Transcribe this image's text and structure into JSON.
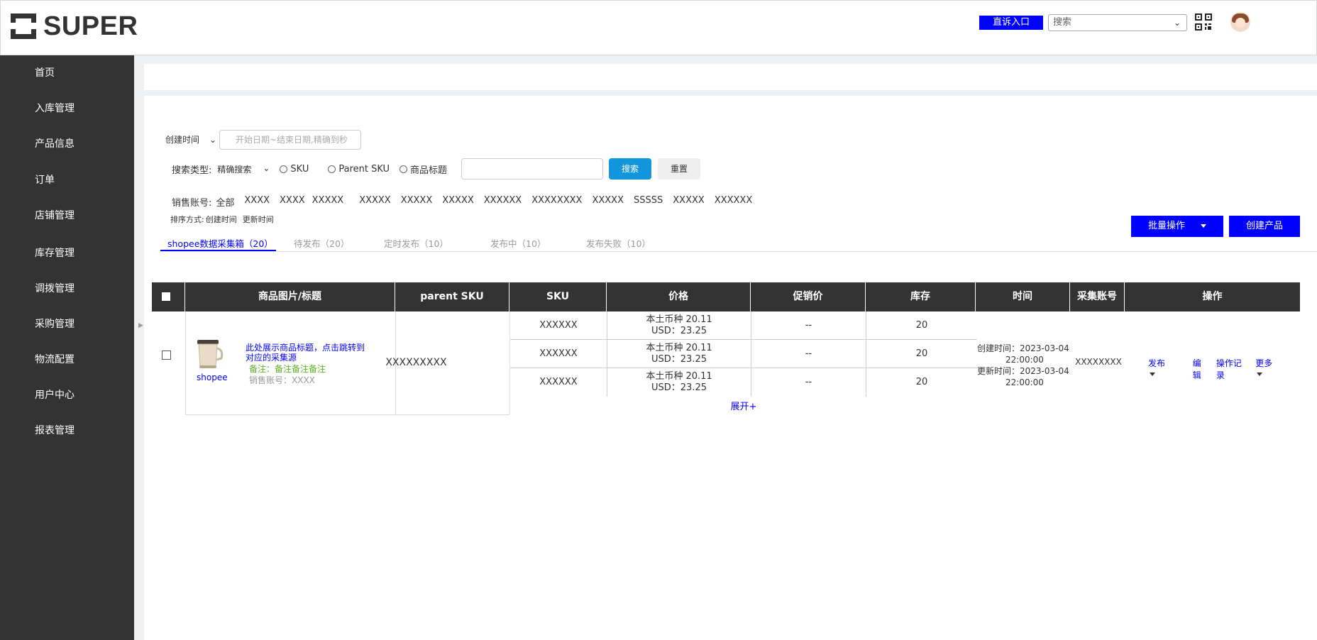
{
  "header": {
    "logo_text": "SUPER",
    "complaint_button": "直诉入口",
    "search_placeholder": "搜索"
  },
  "sidebar": {
    "items": [
      "首页",
      "入库管理",
      "产品信息",
      "订单",
      "店铺管理",
      "库存管理",
      "调拨管理",
      "采购管理",
      "物流配置",
      "用户中心",
      "报表管理"
    ]
  },
  "filters": {
    "time_select": "创建时间",
    "date_placeholder": "开始日期~结束日期,精确到秒",
    "search_type_label": "搜索类型:",
    "search_mode": "精确搜索",
    "radio_options": [
      "SKU",
      "Parent SKU",
      "商品标题"
    ],
    "search_button": "搜索",
    "reset_button": "重置",
    "accounts_label": "销售账号:",
    "accounts": [
      "全部",
      "XXXX",
      "XXXX",
      "XXXXX",
      "XXXXX",
      "XXXXX",
      "XXXXX",
      "XXXXXX",
      "XXXXXXXX",
      "XXXXX",
      "SSSSS",
      "XXXXX",
      "XXXXXX"
    ],
    "sort_label": "排序方式:",
    "sort_options": [
      "创建时间",
      "更新时间"
    ]
  },
  "tabs": [
    {
      "label": "shopee数据采集箱（20）",
      "active": true
    },
    {
      "label": "待发布（20）",
      "active": false
    },
    {
      "label": "定时发布（10）",
      "active": false
    },
    {
      "label": "发布中（10）",
      "active": false
    },
    {
      "label": "发布失败（10）",
      "active": false
    }
  ],
  "actions": {
    "batch_button": "批量操作",
    "create_button": "创建产品"
  },
  "table": {
    "columns": [
      "商品图片/标题",
      "parent SKU",
      "SKU",
      "价格",
      "促销价",
      "库存",
      "时间",
      "采集账号",
      "操作"
    ],
    "product": {
      "platform": "shopee",
      "title": "此处展示商品标题，点击跳转到对应的采集源",
      "note": "备注：备注备注备注",
      "account": "销售账号：XXXX",
      "parent_sku": "XXXXXXXXX",
      "skus": [
        {
          "sku": "XXXXXX",
          "price_local": "本土币种 20.11",
          "price_usd": "USD：23.25",
          "promo": "--",
          "stock": "20"
        },
        {
          "sku": "XXXXXX",
          "price_local": "本土币种 20.11",
          "price_usd": "USD：23.25",
          "promo": "--",
          "stock": "20"
        },
        {
          "sku": "XXXXXX",
          "price_local": "本土币种 20.11",
          "price_usd": "USD：23.25",
          "promo": "--",
          "stock": "20"
        }
      ],
      "expand": "展开+",
      "created_label": "创建时间：2023-03-04",
      "created_time": "22:00:00",
      "updated_label": "更新时间：2023-03-04",
      "updated_time": "22:00:00",
      "collect_account": "XXXXXXXX",
      "ops": [
        "发布",
        "编辑",
        "操作记录",
        "更多"
      ]
    }
  },
  "colors": {
    "accent": "#0000ff",
    "sidebar_bg": "#333333",
    "search_button": "#1296db",
    "note_green": "#5fb020"
  }
}
